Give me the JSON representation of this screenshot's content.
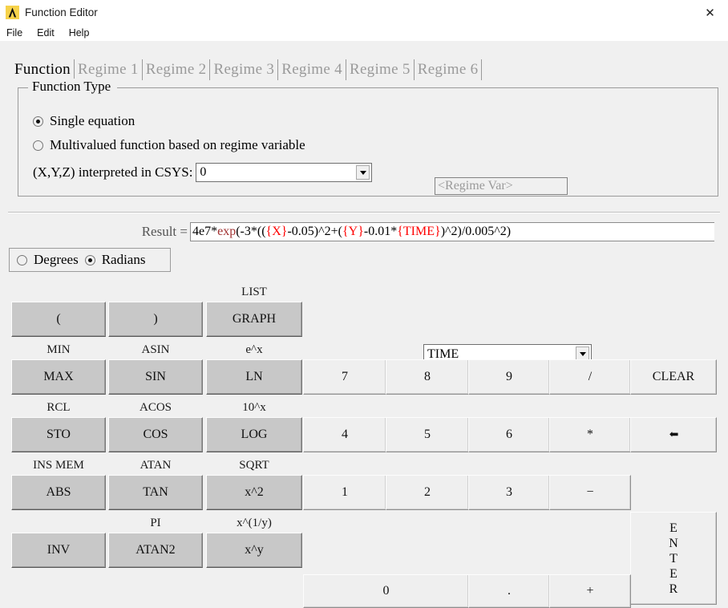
{
  "window": {
    "title": "Function Editor",
    "icon": "lambda-icon",
    "close_label": "✕"
  },
  "menubar": {
    "items": [
      {
        "label": "File"
      },
      {
        "label": "Edit"
      },
      {
        "label": "Help"
      }
    ]
  },
  "tabs": [
    {
      "label": "Function",
      "active": true
    },
    {
      "label": "Regime 1",
      "active": false
    },
    {
      "label": "Regime 2",
      "active": false
    },
    {
      "label": "Regime 3",
      "active": false
    },
    {
      "label": "Regime 4",
      "active": false
    },
    {
      "label": "Regime 5",
      "active": false
    },
    {
      "label": "Regime 6",
      "active": false
    }
  ],
  "function_type": {
    "legend": "Function Type",
    "single_equation": {
      "label": "Single equation",
      "checked": true
    },
    "multivalued": {
      "label": "Multivalued function based on regime variable",
      "checked": false
    },
    "regime_var_placeholder": "<Regime Var>",
    "csys": {
      "label": "(X,Y,Z) interpreted in CSYS:",
      "value": "0"
    }
  },
  "result": {
    "label": "Result =",
    "value": "4e7*exp(-3*(({X}-0.05)^2+({Y}-0.01*{TIME})^2)/0.005^2)",
    "tokens": [
      {
        "t": "4e7*",
        "k": "plain"
      },
      {
        "t": "exp",
        "k": "fn"
      },
      {
        "t": "(-3*((",
        "k": "plain"
      },
      {
        "t": "{X}",
        "k": "var"
      },
      {
        "t": "-0.05)^2+(",
        "k": "plain"
      },
      {
        "t": "{Y}",
        "k": "var"
      },
      {
        "t": "-0.01*",
        "k": "plain"
      },
      {
        "t": "{TIME}",
        "k": "var"
      },
      {
        "t": ")^2)/0.005^2)",
        "k": "plain"
      }
    ],
    "colors": {
      "function": "#a03030",
      "variable": "#ff0000"
    }
  },
  "angle_mode": {
    "degrees": {
      "label": "Degrees",
      "checked": false
    },
    "radians": {
      "label": "Radians",
      "checked": true
    }
  },
  "list_combo": {
    "value": "TIME"
  },
  "keypad": {
    "rows": [
      {
        "shift": [
          "",
          "",
          "LIST"
        ],
        "main": [
          "(",
          ")",
          "GRAPH"
        ]
      },
      {
        "shift": [
          "MIN",
          "ASIN",
          "e^x"
        ],
        "main": [
          "MAX",
          "SIN",
          "LN"
        ]
      },
      {
        "shift": [
          "RCL",
          "ACOS",
          "10^x"
        ],
        "main": [
          "STO",
          "COS",
          "LOG"
        ]
      },
      {
        "shift": [
          "INS MEM",
          "ATAN",
          "SQRT"
        ],
        "main": [
          "ABS",
          "TAN",
          "x^2"
        ]
      },
      {
        "shift": [
          "",
          "PI",
          "x^(1/y)"
        ],
        "main": [
          "INV",
          "ATAN2",
          "x^y"
        ]
      }
    ],
    "numpad": {
      "row1": [
        "7",
        "8",
        "9",
        "/",
        "CLEAR"
      ],
      "row2": [
        "4",
        "5",
        "6",
        "*",
        "⬅"
      ],
      "row3": [
        "1",
        "2",
        "3",
        "−"
      ],
      "row4": [
        "0",
        ".",
        "+"
      ],
      "enter": "ENTER",
      "backspace_icon": "backspace-icon"
    }
  }
}
